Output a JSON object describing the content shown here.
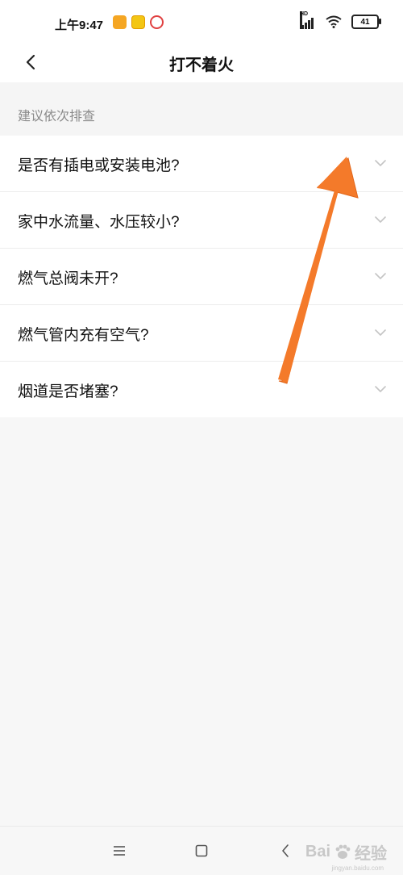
{
  "status_bar": {
    "time": "上午9:47",
    "app_icons": [
      "notes-app-icon",
      "game-app-icon",
      "cloud-app-icon"
    ],
    "network_label": "HD",
    "battery_level": "41"
  },
  "header": {
    "title": "打不着火"
  },
  "section": {
    "heading": "建议依次排查"
  },
  "items": [
    {
      "label": "是否有插电或安装电池?"
    },
    {
      "label": "家中水流量、水压较小?"
    },
    {
      "label": "燃气总阀未开?"
    },
    {
      "label": "燃气管内充有空气?"
    },
    {
      "label": "烟道是否堵塞?"
    }
  ],
  "watermark": {
    "brand": "Bai",
    "suffix": "经验",
    "url": "jingyan.baidu.com"
  },
  "colors": {
    "arrow": "#f47a2a",
    "background": "#f7f7f7",
    "card": "#ffffff",
    "muted_text": "#8a8a8a"
  }
}
